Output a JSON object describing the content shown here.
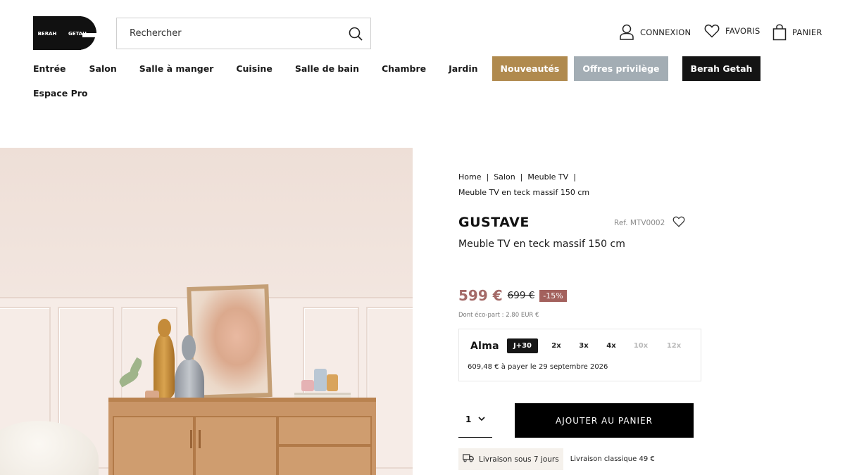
{
  "header": {
    "logo_left": "BERAH",
    "logo_right": "GETAH",
    "search_placeholder": "Rechercher",
    "login_label": "CONNEXION",
    "favorites_label": "FAVORIS",
    "cart_label": "PANIER"
  },
  "nav": {
    "items": [
      "Entrée",
      "Salon",
      "Salle à manger",
      "Cuisine",
      "Salle de bain",
      "Chambre",
      "Jardin"
    ],
    "highlight_new": "Nouveautés",
    "highlight_offers": "Offres privilège",
    "highlight_brand": "Berah Getah",
    "second_row": "Espace Pro",
    "colors": {
      "new": "#b08a4e",
      "offers": "#a3adb4",
      "brand": "#141414"
    }
  },
  "breadcrumb": {
    "items": [
      "Home",
      "Salon",
      "Meuble TV"
    ],
    "current": "Meuble TV en teck massif 150 cm"
  },
  "product": {
    "brand": "GUSTAVE",
    "reference": "Ref. MTV0002",
    "title": "Meuble TV en teck massif 150 cm",
    "price": "599 €",
    "old_price": "699 €",
    "discount": "-15%",
    "eco_part": "Dont éco-part : 2.80 EUR €",
    "price_color": "#a46a68"
  },
  "alma": {
    "name": "Alma",
    "options": [
      "J+30",
      "2x",
      "3x",
      "4x",
      "10x",
      "12x"
    ],
    "selected": "J+30",
    "disabled": [
      "10x",
      "12x"
    ],
    "terms": "609,48 € à payer le 29 septembre 2026"
  },
  "purchase": {
    "quantity": "1",
    "add_to_cart": "AJOUTER AU PANIER"
  },
  "delivery": {
    "delay": "Livraison sous 7 jours",
    "classic": "Livraison classique 49 €"
  },
  "icons": {
    "search": "search-icon",
    "user": "user-icon",
    "heart": "heart-icon",
    "bag": "shopping-bag-icon",
    "truck": "truck-icon",
    "chevron": "chevron-down-icon"
  }
}
